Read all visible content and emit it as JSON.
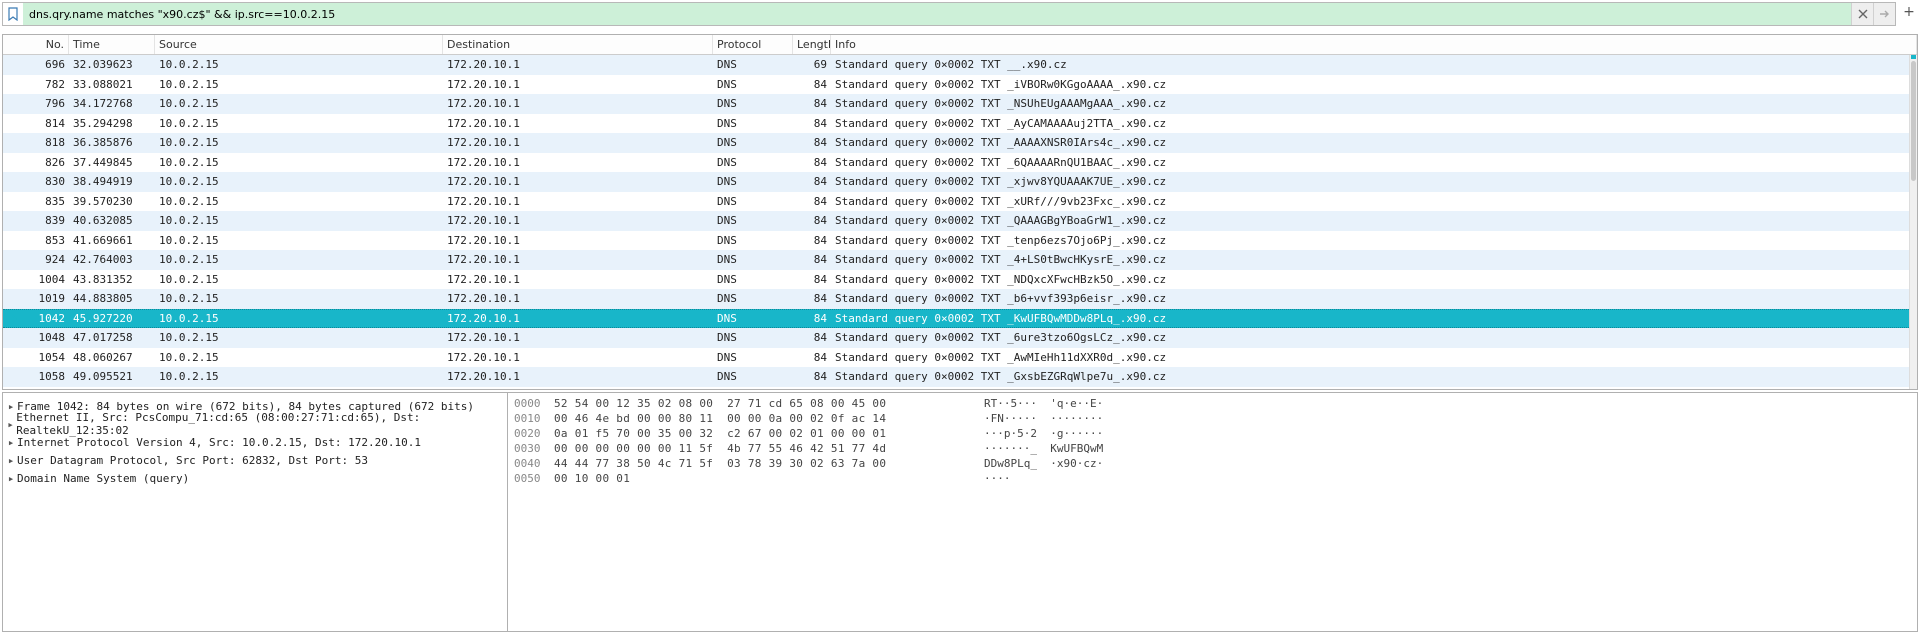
{
  "filter": {
    "value": "dns.qry.name matches \"x90.cz$\" && ip.src==10.0.2.15"
  },
  "columns": {
    "no": "No.",
    "time": "Time",
    "source": "Source",
    "destination": "Destination",
    "protocol": "Protocol",
    "length": "Length",
    "info": "Info"
  },
  "packets": [
    {
      "no": "696",
      "time": "32.039623",
      "src": "10.0.2.15",
      "dst": "172.20.10.1",
      "proto": "DNS",
      "len": "69",
      "info": "Standard query 0×0002 TXT __.x90.cz"
    },
    {
      "no": "782",
      "time": "33.088021",
      "src": "10.0.2.15",
      "dst": "172.20.10.1",
      "proto": "DNS",
      "len": "84",
      "info": "Standard query 0×0002 TXT _iVBORw0KGgoAAAA_.x90.cz"
    },
    {
      "no": "796",
      "time": "34.172768",
      "src": "10.0.2.15",
      "dst": "172.20.10.1",
      "proto": "DNS",
      "len": "84",
      "info": "Standard query 0×0002 TXT _NSUhEUgAAAMgAAA_.x90.cz"
    },
    {
      "no": "814",
      "time": "35.294298",
      "src": "10.0.2.15",
      "dst": "172.20.10.1",
      "proto": "DNS",
      "len": "84",
      "info": "Standard query 0×0002 TXT _AyCAMAAAAuj2TTA_.x90.cz"
    },
    {
      "no": "818",
      "time": "36.385876",
      "src": "10.0.2.15",
      "dst": "172.20.10.1",
      "proto": "DNS",
      "len": "84",
      "info": "Standard query 0×0002 TXT _AAAAXNSR0IArs4c_.x90.cz"
    },
    {
      "no": "826",
      "time": "37.449845",
      "src": "10.0.2.15",
      "dst": "172.20.10.1",
      "proto": "DNS",
      "len": "84",
      "info": "Standard query 0×0002 TXT _6QAAAARnQU1BAAC_.x90.cz"
    },
    {
      "no": "830",
      "time": "38.494919",
      "src": "10.0.2.15",
      "dst": "172.20.10.1",
      "proto": "DNS",
      "len": "84",
      "info": "Standard query 0×0002 TXT _xjwv8YQUAAAK7UE_.x90.cz"
    },
    {
      "no": "835",
      "time": "39.570230",
      "src": "10.0.2.15",
      "dst": "172.20.10.1",
      "proto": "DNS",
      "len": "84",
      "info": "Standard query 0×0002 TXT _xURf///9vb23Fxc_.x90.cz"
    },
    {
      "no": "839",
      "time": "40.632085",
      "src": "10.0.2.15",
      "dst": "172.20.10.1",
      "proto": "DNS",
      "len": "84",
      "info": "Standard query 0×0002 TXT _QAAAGBgYBoaGrW1_.x90.cz"
    },
    {
      "no": "853",
      "time": "41.669661",
      "src": "10.0.2.15",
      "dst": "172.20.10.1",
      "proto": "DNS",
      "len": "84",
      "info": "Standard query 0×0002 TXT _tenp6ezs7Ojo6Pj_.x90.cz"
    },
    {
      "no": "924",
      "time": "42.764003",
      "src": "10.0.2.15",
      "dst": "172.20.10.1",
      "proto": "DNS",
      "len": "84",
      "info": "Standard query 0×0002 TXT _4+LS0tBwcHKysrE_.x90.cz"
    },
    {
      "no": "1004",
      "time": "43.831352",
      "src": "10.0.2.15",
      "dst": "172.20.10.1",
      "proto": "DNS",
      "len": "84",
      "info": "Standard query 0×0002 TXT _NDQxcXFwcHBzk5O_.x90.cz"
    },
    {
      "no": "1019",
      "time": "44.883805",
      "src": "10.0.2.15",
      "dst": "172.20.10.1",
      "proto": "DNS",
      "len": "84",
      "info": "Standard query 0×0002 TXT _b6+vvf393p6eisr_.x90.cz"
    },
    {
      "no": "1042",
      "time": "45.927220",
      "src": "10.0.2.15",
      "dst": "172.20.10.1",
      "proto": "DNS",
      "len": "84",
      "info": "Standard query 0×0002 TXT _KwUFBQwMDDw8PLq_.x90.cz",
      "selected": true
    },
    {
      "no": "1048",
      "time": "47.017258",
      "src": "10.0.2.15",
      "dst": "172.20.10.1",
      "proto": "DNS",
      "len": "84",
      "info": "Standard query 0×0002 TXT _6ure3tzo6OgsLCz_.x90.cz"
    },
    {
      "no": "1054",
      "time": "48.060267",
      "src": "10.0.2.15",
      "dst": "172.20.10.1",
      "proto": "DNS",
      "len": "84",
      "info": "Standard query 0×0002 TXT _AwMIeHh11dXXR0d_.x90.cz"
    },
    {
      "no": "1058",
      "time": "49.095521",
      "src": "10.0.2.15",
      "dst": "172.20.10.1",
      "proto": "DNS",
      "len": "84",
      "info": "Standard query 0×0002 TXT _GxsbEZGRqWlpe7u_.x90.cz"
    }
  ],
  "tree": [
    "Frame 1042: 84 bytes on wire (672 bits), 84 bytes captured (672 bits)",
    "Ethernet II, Src: PcsCompu_71:cd:65 (08:00:27:71:cd:65), Dst: RealtekU_12:35:02",
    "Internet Protocol Version 4, Src: 10.0.2.15, Dst: 172.20.10.1",
    "User Datagram Protocol, Src Port: 62832, Dst Port: 53",
    "Domain Name System (query)"
  ],
  "hex": [
    {
      "off": "0000",
      "bytes": "52 54 00 12 35 02 08 00  27 71 cd 65 08 00 45 00",
      "ascii": "RT··5···  'q·e··E·"
    },
    {
      "off": "0010",
      "bytes": "00 46 4e bd 00 00 80 11  00 00 0a 00 02 0f ac 14",
      "ascii": "·FN·····  ········"
    },
    {
      "off": "0020",
      "bytes": "0a 01 f5 70 00 35 00 32  c2 67 00 02 01 00 00 01",
      "ascii": "···p·5·2  ·g······"
    },
    {
      "off": "0030",
      "bytes": "00 00 00 00 00 00 11 5f  4b 77 55 46 42 51 77 4d",
      "ascii": "·······_  KwUFBQwM"
    },
    {
      "off": "0040",
      "bytes": "44 44 77 38 50 4c 71 5f  03 78 39 30 02 63 7a 00",
      "ascii": "DDw8PLq_  ·x90·cz·"
    },
    {
      "off": "0050",
      "bytes": "00 10 00 01",
      "ascii": "····"
    }
  ]
}
